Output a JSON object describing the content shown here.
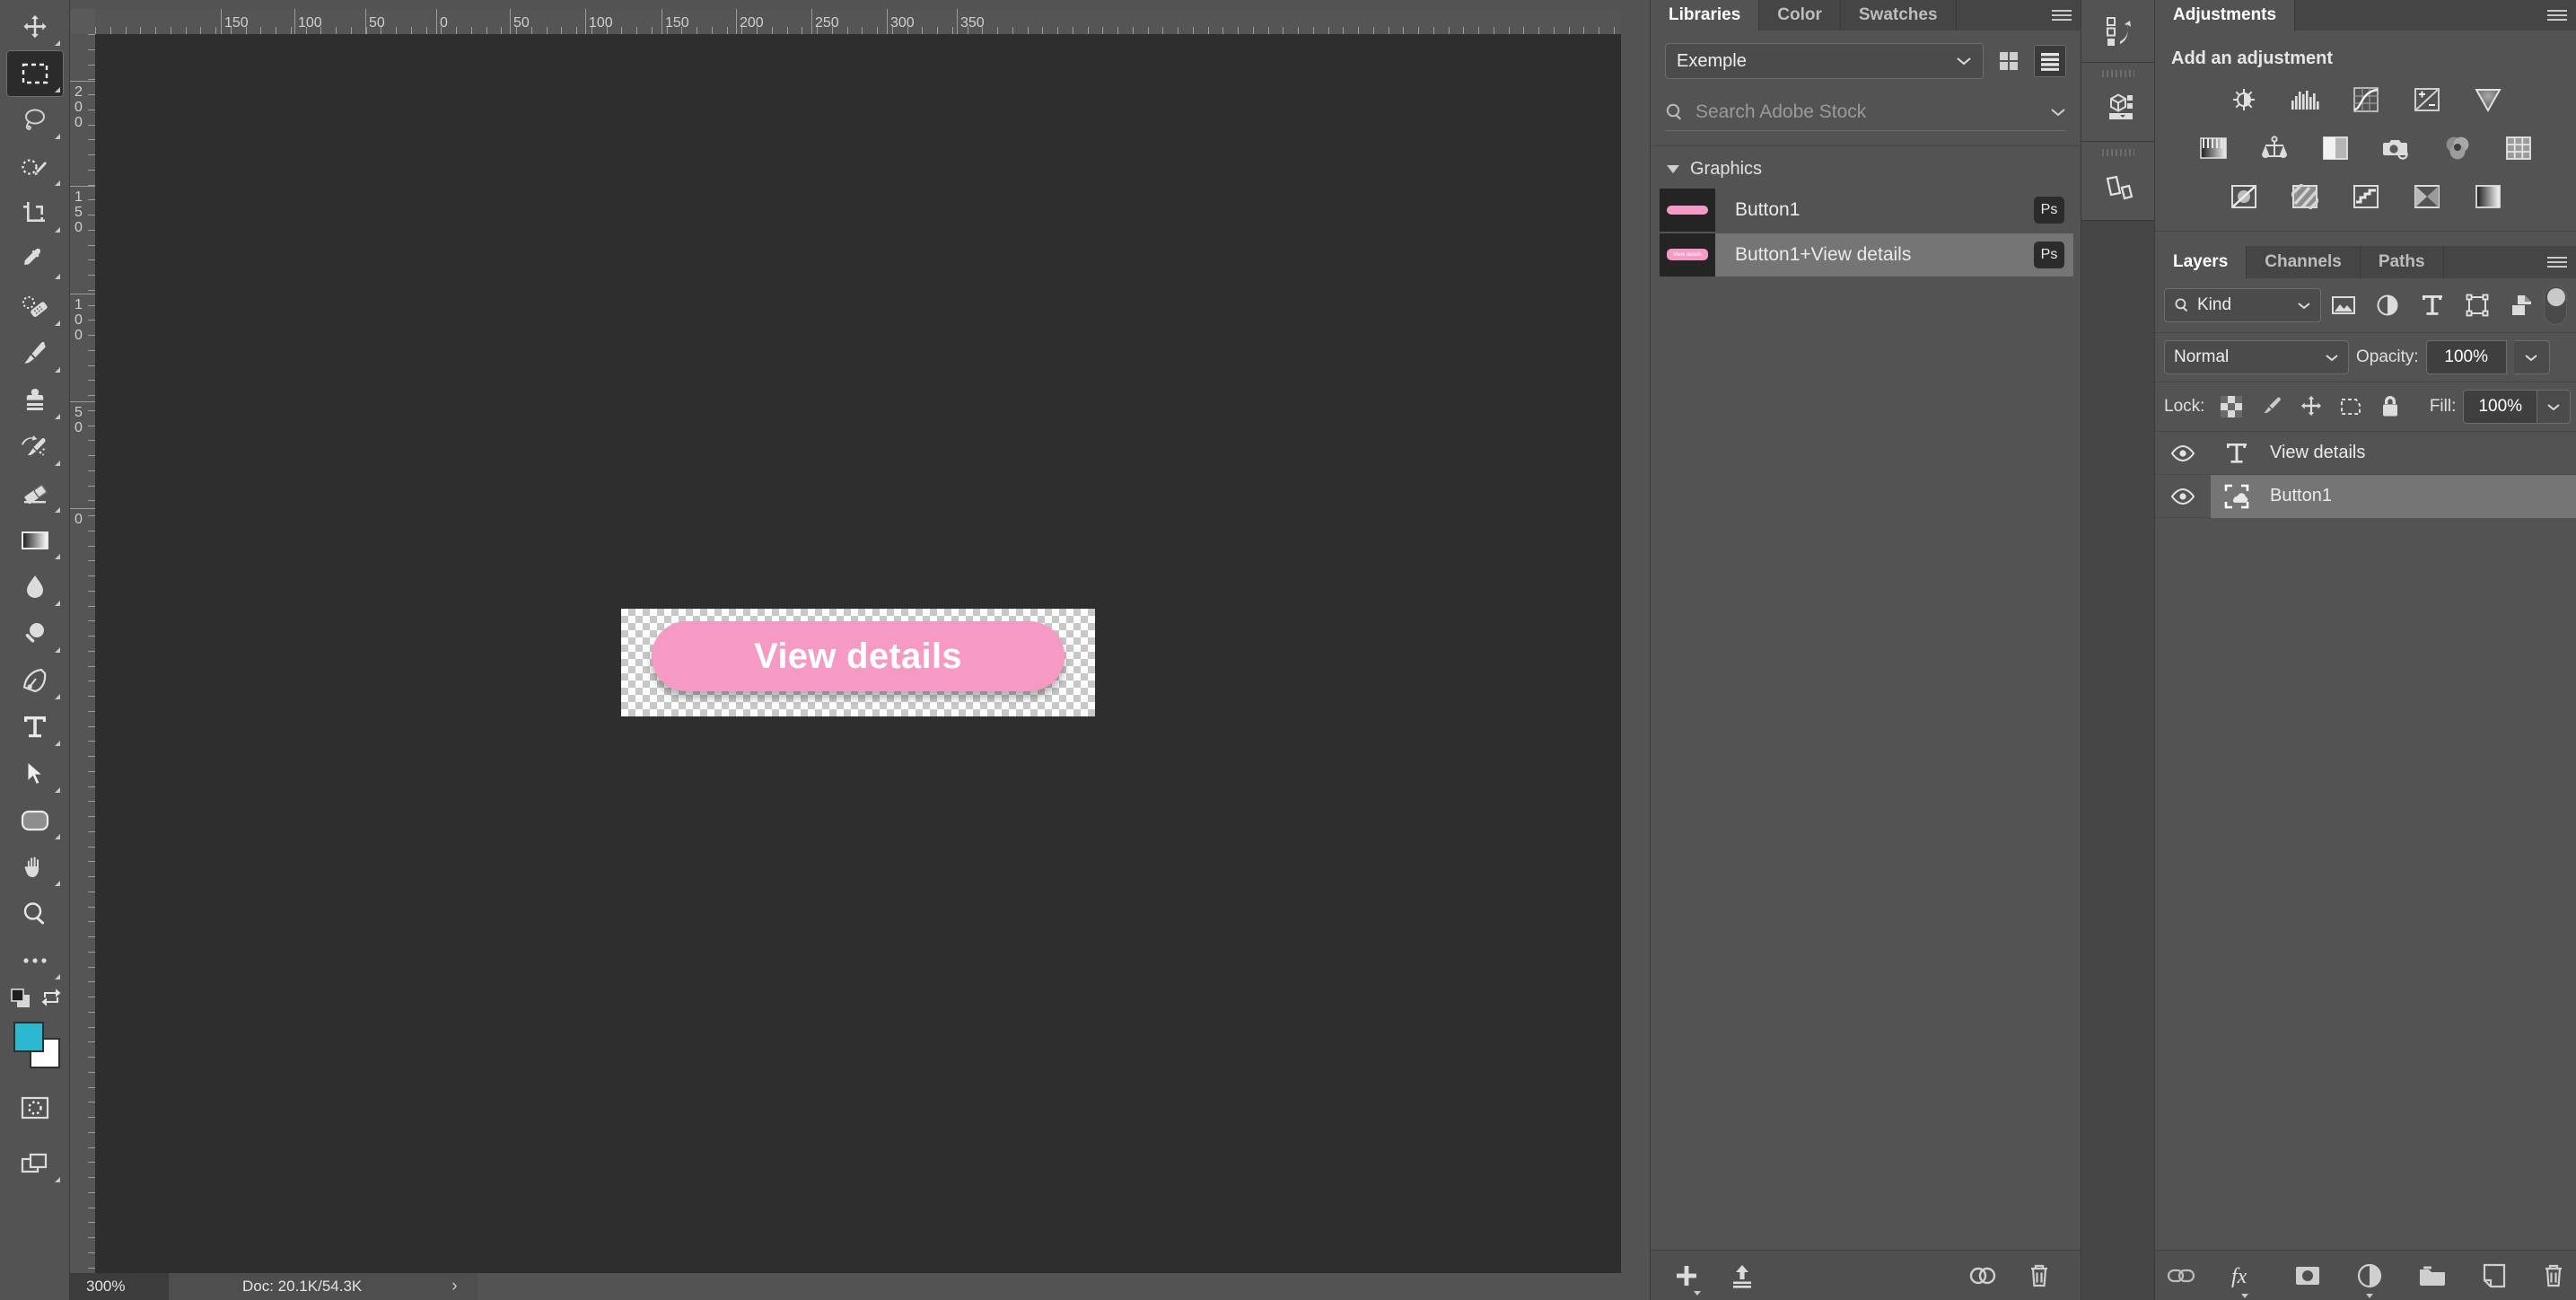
{
  "app": {
    "name": "Adobe Photoshop"
  },
  "toolbar": {
    "tools": [
      {
        "name": "move-tool",
        "icon": "move-icon",
        "active": false
      },
      {
        "name": "rectangular-marquee-tool",
        "icon": "marquee-icon",
        "active": true
      },
      {
        "name": "lasso-tool",
        "icon": "lasso-icon",
        "active": false
      },
      {
        "name": "object-selection-tool",
        "icon": "quick-selection-icon",
        "active": false
      },
      {
        "name": "crop-tool",
        "icon": "crop-icon",
        "active": false
      },
      {
        "name": "eyedropper-tool",
        "icon": "eyedropper-icon",
        "active": false
      },
      {
        "name": "spot-healing-brush-tool",
        "icon": "healing-brush-icon",
        "active": false
      },
      {
        "name": "brush-tool",
        "icon": "brush-icon",
        "active": false
      },
      {
        "name": "clone-stamp-tool",
        "icon": "clone-stamp-icon",
        "active": false
      },
      {
        "name": "history-brush-tool",
        "icon": "history-brush-icon",
        "active": false
      },
      {
        "name": "eraser-tool",
        "icon": "eraser-icon",
        "active": false
      },
      {
        "name": "gradient-tool",
        "icon": "gradient-icon",
        "active": false
      },
      {
        "name": "blur-tool",
        "icon": "blur-droplet-icon",
        "active": false
      },
      {
        "name": "dodge-tool",
        "icon": "dodge-icon",
        "active": false
      },
      {
        "name": "pen-tool",
        "icon": "pen-icon",
        "active": false
      },
      {
        "name": "type-tool",
        "icon": "type-t-icon",
        "active": false
      },
      {
        "name": "path-selection-tool",
        "icon": "path-arrow-icon",
        "active": false
      },
      {
        "name": "rectangle-tool",
        "icon": "rounded-rectangle-icon",
        "active": false
      },
      {
        "name": "hand-tool",
        "icon": "hand-icon",
        "active": false
      },
      {
        "name": "zoom-tool",
        "icon": "magnifier-icon",
        "active": false
      },
      {
        "name": "edit-toolbar-tool",
        "icon": "ellipsis-icon",
        "active": false
      }
    ],
    "default_colors": {
      "name": "default-colors-icon"
    },
    "swap_colors": {
      "name": "swap-colors-icon"
    },
    "foreground_color": "#2bb8d0",
    "background_color": "#ffffff",
    "quick_mask": {
      "name": "quick-mask-icon"
    },
    "screen_mode": {
      "name": "screen-mode-icon"
    }
  },
  "rulers": {
    "unit": "px",
    "horizontal_labels": [
      "150",
      "100",
      "50",
      "0",
      "50",
      "100",
      "150",
      "200",
      "250",
      "300",
      "350"
    ],
    "horizontal_positions": [
      140,
      222,
      301,
      380,
      462,
      546,
      631,
      714,
      798,
      882,
      960
    ],
    "vertical_labels": [
      "200",
      "150",
      "100",
      "50",
      "0"
    ],
    "vertical_positions": [
      52,
      169,
      289,
      409,
      528
    ]
  },
  "canvas": {
    "artwork_label": "View details",
    "button_color": "#f49ac4",
    "text_color": "#ffffff"
  },
  "status_bar": {
    "zoom": "300%",
    "doc_info": "Doc: 20.1K/54.3K",
    "expand_icon": "chevron-right-icon",
    "chevron": "›"
  },
  "libraries": {
    "tabs": [
      {
        "label": "Libraries",
        "active": true
      },
      {
        "label": "Color",
        "active": false
      },
      {
        "label": "Swatches",
        "active": false
      }
    ],
    "menu_icon": "panel-menu-icon",
    "selected_library": "Exemple",
    "dropdown_icon": "chevron-down-icon",
    "view_grid_icon": "grid-view-icon",
    "view_list_icon": "list-view-icon",
    "search": {
      "placeholder": "Search Adobe Stock",
      "icon": "search-icon",
      "filter_icon": "chevron-down-icon"
    },
    "group": {
      "label": "Graphics",
      "caret": "caret-down-icon"
    },
    "items": [
      {
        "label": "Button1",
        "badge": "Ps",
        "selected": false,
        "thumb_label": ""
      },
      {
        "label": "Button1+View details",
        "badge": "Ps",
        "selected": true,
        "thumb_label": "View details"
      }
    ],
    "footer": {
      "add_icon": "plus-icon",
      "upload_icon": "upload-icon",
      "cc_icon": "creative-cloud-icon",
      "delete_icon": "trash-icon"
    }
  },
  "dock": {
    "buttons": [
      {
        "name": "history-panel-icon"
      },
      {
        "name": "3d-panel-icon"
      },
      {
        "name": "paths-shapes-panel-icon"
      }
    ]
  },
  "adjustments": {
    "tabs": [
      {
        "label": "Adjustments",
        "active": true
      }
    ],
    "menu_icon": "panel-menu-icon",
    "title": "Add an adjustment",
    "row1": [
      {
        "name": "brightness-contrast-icon"
      },
      {
        "name": "levels-icon"
      },
      {
        "name": "curves-icon"
      },
      {
        "name": "exposure-icon"
      },
      {
        "name": "vibrance-icon"
      }
    ],
    "row2": [
      {
        "name": "hue-saturation-icon"
      },
      {
        "name": "color-balance-icon"
      },
      {
        "name": "black-white-icon"
      },
      {
        "name": "photo-filter-icon"
      },
      {
        "name": "channel-mixer-icon"
      },
      {
        "name": "color-lookup-icon"
      }
    ],
    "row3": [
      {
        "name": "invert-icon"
      },
      {
        "name": "posterize-icon"
      },
      {
        "name": "threshold-icon"
      },
      {
        "name": "selective-color-icon"
      },
      {
        "name": "gradient-map-icon"
      }
    ]
  },
  "layers": {
    "tabs": [
      {
        "label": "Layers",
        "active": true
      },
      {
        "label": "Channels",
        "active": false
      },
      {
        "label": "Paths",
        "active": false
      }
    ],
    "menu_icon": "panel-menu-icon",
    "filter": {
      "kind_label": "Kind",
      "search_icon": "search-icon",
      "dropdown_icon": "chevron-down-icon",
      "pixel_filter_icon": "pixel-layer-filter-icon",
      "adjustment_filter_icon": "adjustment-layer-filter-icon",
      "type_filter_icon": "type-layer-filter-icon",
      "shape_filter_icon": "shape-layer-filter-icon",
      "smart_object_filter_icon": "smart-object-filter-icon",
      "toggle_icon": "filter-toggle-switch"
    },
    "blend_mode": "Normal",
    "opacity_label": "Opacity:",
    "opacity_value": "100%",
    "lock_label": "Lock:",
    "lock_icons": [
      {
        "name": "lock-transparent-pixels-icon"
      },
      {
        "name": "lock-image-pixels-icon"
      },
      {
        "name": "lock-position-icon"
      },
      {
        "name": "lock-artboard-nesting-icon"
      },
      {
        "name": "lock-all-icon"
      }
    ],
    "fill_label": "Fill:",
    "fill_value": "100%",
    "rows": [
      {
        "name": "View details",
        "type": "text",
        "visible": true,
        "selected": false
      },
      {
        "name": "Button1",
        "type": "linked-smart-object",
        "visible": true,
        "selected": true
      }
    ],
    "footer": {
      "link_icon": "link-layers-icon",
      "fx_icon": "layer-styles-fx-icon",
      "mask_icon": "add-layer-mask-icon",
      "adjustment_icon": "new-adjustment-layer-icon",
      "group_icon": "new-group-icon",
      "new_layer_icon": "new-layer-icon",
      "delete_icon": "delete-layer-icon"
    }
  }
}
